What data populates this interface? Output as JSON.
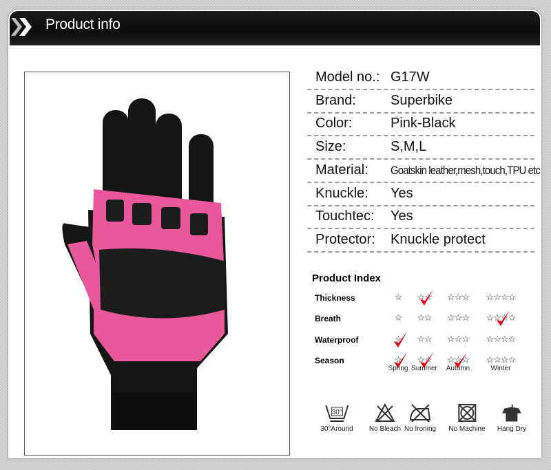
{
  "header": {
    "title": "Product info"
  },
  "specs": [
    {
      "label": "Model no.:",
      "value": "G17W"
    },
    {
      "label": "Brand:",
      "value": "Superbike"
    },
    {
      "label": "Color:",
      "value": "Pink-Black"
    },
    {
      "label": "Size:",
      "value": "S,M,L"
    },
    {
      "label": "Material:",
      "value": "Goatskin leather,mesh,touch,TPU etc"
    },
    {
      "label": "Knuckle:",
      "value": "Yes"
    },
    {
      "label": "Touchtec:",
      "value": "Yes"
    },
    {
      "label": "Protector:",
      "value": "Knuckle protect"
    }
  ],
  "product_index": {
    "title": "Product Index",
    "levels": [
      "☆",
      "☆☆",
      "☆☆☆",
      "☆☆☆☆"
    ],
    "rows": [
      {
        "label": "Thickness",
        "checked": [
          2
        ]
      },
      {
        "label": "Breath",
        "checked": [
          4
        ]
      },
      {
        "label": "Waterproof",
        "checked": [
          1
        ]
      },
      {
        "label": "Season",
        "checked": [
          1,
          2,
          3
        ]
      }
    ],
    "seasons": [
      "Spring",
      "Summer",
      "Autumn",
      "Winter"
    ],
    "check_color": "#e0000f"
  },
  "care": [
    {
      "icon": "wash-30-icon",
      "label": "30°Around",
      "temp": "30°"
    },
    {
      "icon": "no-bleach-icon",
      "label": "No Bleach"
    },
    {
      "icon": "no-ironing-icon",
      "label": "No Ironing"
    },
    {
      "icon": "no-machine-icon",
      "label": "No Machine"
    },
    {
      "icon": "hang-dry-icon",
      "label": "Hang Dry"
    }
  ],
  "product": {
    "colors": {
      "pink": "#e8589a",
      "black": "#141414"
    }
  }
}
